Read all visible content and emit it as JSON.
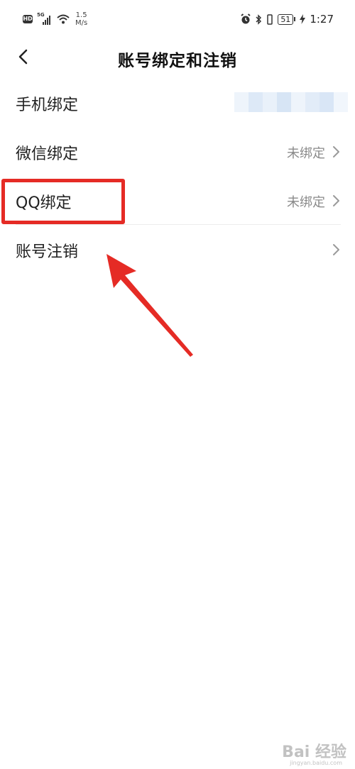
{
  "status_bar": {
    "left": {
      "hd": "HD",
      "network": "5G",
      "speed_value": "1.5",
      "speed_unit": "M/s"
    },
    "right": {
      "battery": "51",
      "time": "1:27",
      "icons": [
        "alarm-icon",
        "bluetooth-icon",
        "vibrate-icon",
        "charging-icon"
      ]
    }
  },
  "header": {
    "title": "账号绑定和注销",
    "back_icon": "chevron-left-icon"
  },
  "list": {
    "items": [
      {
        "label": "手机绑定",
        "value": "",
        "value_blurred": true,
        "chevron": false
      },
      {
        "label": "微信绑定",
        "value": "未绑定",
        "value_blurred": false,
        "chevron": true
      },
      {
        "label": "QQ绑定",
        "value": "未绑定",
        "value_blurred": false,
        "chevron": true
      },
      {
        "label": "账号注销",
        "value": "",
        "value_blurred": false,
        "chevron": true
      }
    ]
  },
  "annotations": {
    "highlight_color": "#e52b25",
    "arrow_color": "#e52b25"
  },
  "watermark": {
    "text": "Bai 经验",
    "sub": "jingyan.baidu.com"
  }
}
